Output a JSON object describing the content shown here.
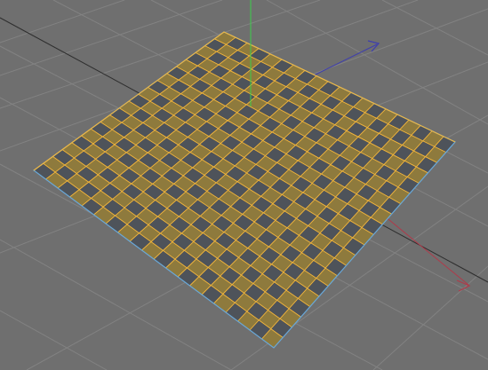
{
  "viewport": {
    "projection": "perspective",
    "background_color": "#6f6f6f",
    "grid_line_color": "#828282",
    "horizon_line_color": "#2e2e2e"
  },
  "plane": {
    "object_type": "plane",
    "selected": true,
    "segments_width": 20,
    "segments_height": 20,
    "checker_light_color": "#8e7a3d",
    "checker_dark_color": "#4e535a",
    "selection_edge_color": "#f4b63a",
    "boundary_edge_color": "#69a8d8"
  },
  "axes": {
    "x_axis": {
      "icon": "x-axis-arrow",
      "color": "#b03a4a"
    },
    "y_axis": {
      "icon": "y-axis-line",
      "color": "#3bcc4a"
    },
    "z_axis": {
      "icon": "z-axis-arrow",
      "color": "#3e3eae"
    }
  }
}
